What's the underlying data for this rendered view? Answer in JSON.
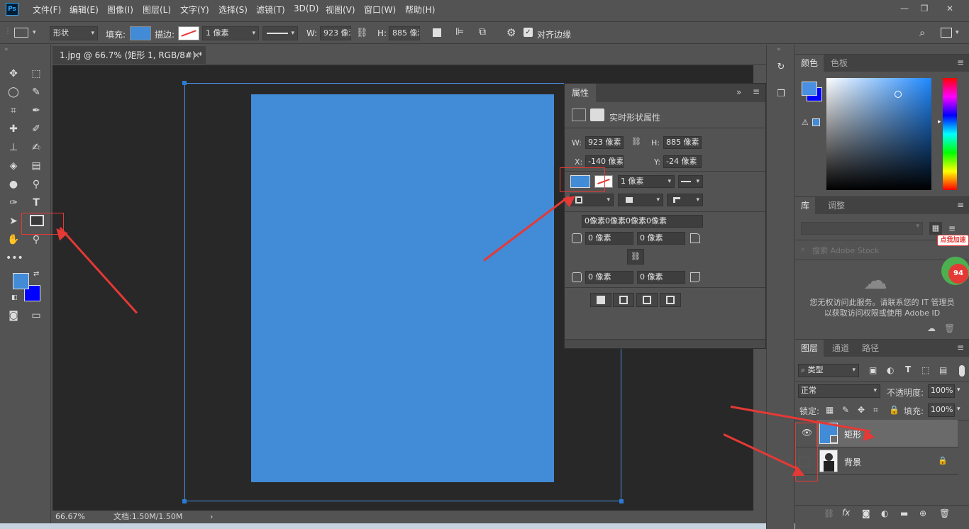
{
  "app": {
    "logo": "Ps"
  },
  "menu": [
    "文件(F)",
    "编辑(E)",
    "图像(I)",
    "图层(L)",
    "文字(Y)",
    "选择(S)",
    "滤镜(T)",
    "3D(D)",
    "视图(V)",
    "窗口(W)",
    "帮助(H)"
  ],
  "options": {
    "mode": "形状",
    "fill_label": "填充:",
    "stroke_label": "描边:",
    "stroke_width": "1 像素",
    "w_label": "W:",
    "w_value": "923 像素",
    "h_label": "H:",
    "h_value": "885 像素",
    "align_edges": "对齐边缘",
    "fill_color": "#428bd7"
  },
  "document": {
    "tab_title": "1.jpg @ 66.7% (矩形 1, RGB/8#) *",
    "zoom": "66.67%",
    "doc_info": "文档:1.50M/1.50M"
  },
  "properties": {
    "title": "属性",
    "subtitle": "实时形状属性",
    "w_label": "W:",
    "w": "923 像素",
    "h_label": "H:",
    "h": "885 像素",
    "x_label": "X:",
    "x": "-140 像素",
    "y_label": "Y:",
    "y": "-24 像素",
    "stroke_width": "1 像素",
    "corners_all": "0像素0像素0像素0像素",
    "corner_tl": "0 像素",
    "corner_tr": "0 像素",
    "corner_bl": "0 像素",
    "corner_br": "0 像素"
  },
  "color_panel": {
    "tabs": [
      "颜色",
      "色板"
    ],
    "fg": "#4a90e2",
    "bg": "#0000ff"
  },
  "library_panel": {
    "tabs": [
      "库",
      "调整"
    ],
    "search_placeholder": "搜索 Adobe Stock",
    "message": "您无权访问此服务。请联系您的 IT 管理员以获取访问权限或使用 Adobe ID",
    "badge": "点我加速",
    "badge_num": "94"
  },
  "layers_panel": {
    "tabs": [
      "图层",
      "通道",
      "路径"
    ],
    "filter": "类型",
    "blend_mode": "正常",
    "opacity_label": "不透明度:",
    "opacity": "100%",
    "lock_label": "锁定:",
    "fill_label": "填充:",
    "fill": "100%",
    "layers": [
      {
        "name": "矩形 1",
        "visible": true,
        "selected": true
      },
      {
        "name": "背景",
        "visible": false,
        "selected": false
      }
    ]
  }
}
